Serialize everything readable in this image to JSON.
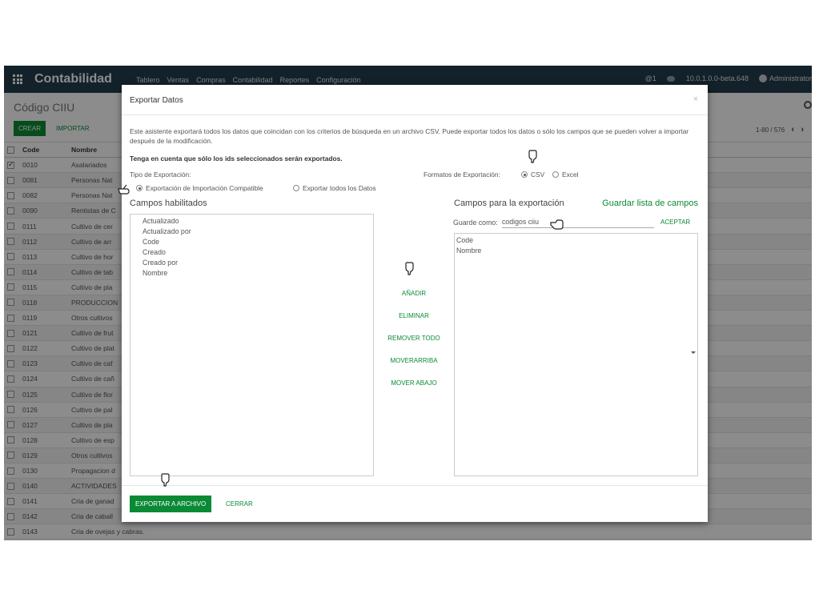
{
  "navbar": {
    "brand": "Contabilidad",
    "menu": [
      "Tablero",
      "Ventas",
      "Compras",
      "Contabilidad",
      "Reportes",
      "Configuración"
    ],
    "notifications": "@1",
    "version": "10.0.1.0.0-beta.648",
    "user": "Administrator"
  },
  "control_panel": {
    "title": "Código CIIU",
    "create_label": "CREAR",
    "import_label": "IMPORTAR",
    "pager": "1-80 / 576"
  },
  "list": {
    "headers": {
      "code": "Code",
      "name": "Nombre"
    },
    "rows": [
      {
        "code": "0010",
        "name": "Asalariados"
      },
      {
        "code": "0081",
        "name": "Personas Nat"
      },
      {
        "code": "0082",
        "name": "Personas Nat"
      },
      {
        "code": "0090",
        "name": "Rentistas de C"
      },
      {
        "code": "0111",
        "name": "Cultivo de cer"
      },
      {
        "code": "0112",
        "name": "Cultivo de arr"
      },
      {
        "code": "0113",
        "name": "Cultivo de hor"
      },
      {
        "code": "0114",
        "name": "Cultivo de tab"
      },
      {
        "code": "0115",
        "name": "Cultivo de pla"
      },
      {
        "code": "0118",
        "name": "PRODUCCION"
      },
      {
        "code": "0119",
        "name": "Otros cultivos"
      },
      {
        "code": "0121",
        "name": "Cultivo de frut"
      },
      {
        "code": "0122",
        "name": "Cultivo de plat"
      },
      {
        "code": "0123",
        "name": "Cultivo de caf"
      },
      {
        "code": "0124",
        "name": "Cultivo de cañ"
      },
      {
        "code": "0125",
        "name": "Cultivo de flor"
      },
      {
        "code": "0126",
        "name": "Cultivo de pal"
      },
      {
        "code": "0127",
        "name": "Cultivo de pla"
      },
      {
        "code": "0128",
        "name": "Cultivo de esp"
      },
      {
        "code": "0129",
        "name": "Otros cultivos"
      },
      {
        "code": "0130",
        "name": "Propagacion d"
      },
      {
        "code": "0140",
        "name": "ACTIVIDADES"
      },
      {
        "code": "0141",
        "name": "Cria de ganad"
      },
      {
        "code": "0142",
        "name": "Cria de caball"
      },
      {
        "code": "0143",
        "name": "Cria de ovejas y cabras."
      }
    ]
  },
  "modal": {
    "title": "Exportar Datos",
    "close": "×",
    "description": "Este asistente exportará todos los datos que coincidan con los criterios de búsqueda en un archivo CSV. Puede exportar todos los datos o sólo los campos que se pueden volver a importar después de la modificación.",
    "note": "Tenga en cuenta que sólo los ids seleccionados serán exportados.",
    "export_type_label": "Tipo de Exportación:",
    "export_type_options": [
      "Exportación de Importación Compatible",
      "Exportar todos los Datos"
    ],
    "format_label": "Formatos de Exportación:",
    "format_options": [
      "CSV",
      "Excel"
    ],
    "available_title": "Campos habilitados",
    "available_fields": [
      "Actualizado",
      "Actualizado por",
      "Code",
      "Creado",
      "Creado por",
      "Nombre"
    ],
    "export_title": "Campos para la exportación",
    "save_list_label": "Guardar lista de campos",
    "save_as_label": "Guarde como:",
    "save_as_value": "codigos ciiu",
    "accept_label": "ACEPTAR",
    "export_fields": [
      "Code",
      "Nombre"
    ],
    "actions": {
      "add": "AÑADIR",
      "remove": "ELIMINAR",
      "remove_all": "REMOVER TODO",
      "move_up": "MOVERARRIBA",
      "move_down": "MOVER ABAJO"
    },
    "export_button": "EXPORTAR A ARCHIVO",
    "close_button": "CERRAR"
  }
}
